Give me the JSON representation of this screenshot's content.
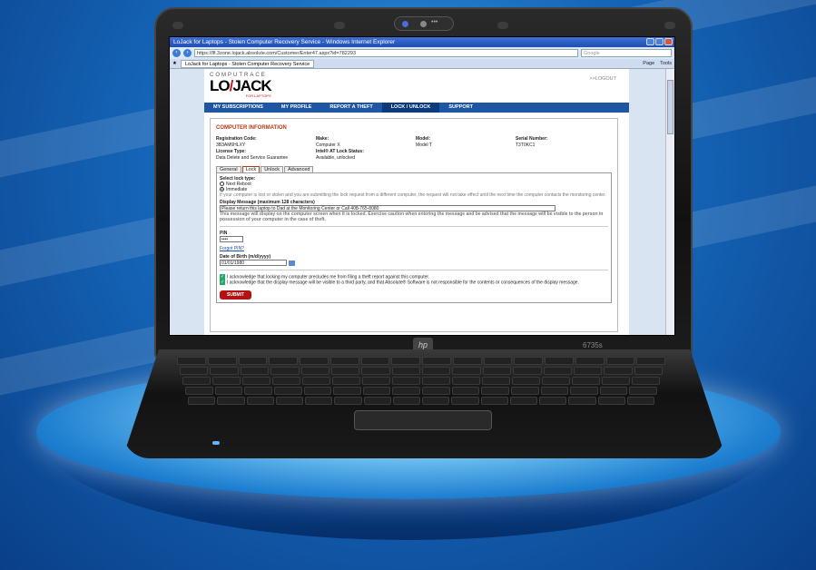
{
  "browser": {
    "window_title": "LoJack for Laptops - Stolen Computer Recovery Service - Windows Internet Explorer",
    "url": "https://lfl.3zone.lojack.absolute.com/Customer/Enter47.aspx?id=782293",
    "search_placeholder": "Google",
    "tab_label": "LoJack for Laptops - Stolen Computer Recovery Service",
    "tools": [
      "Page",
      "Tools"
    ]
  },
  "page": {
    "brand_top": "COMPUTRACE",
    "brand_lo": "LO",
    "brand_jack": "JACK",
    "brand_sub": "FOR LAPTOPS",
    "logout": ">>LOGOUT",
    "nav": [
      "MY SUBSCRIPTIONS",
      "MY PROFILE",
      "REPORT A THEFT",
      "LOCK / UNLOCK",
      "SUPPORT"
    ],
    "section_title": "COMPUTER INFORMATION",
    "info": {
      "reg_label": "Registration Code:",
      "reg_value": "3B3AM6HLXY",
      "make_label": "Make:",
      "make_value": "Computer X",
      "model_label": "Model:",
      "model_value": "Model T",
      "serial_label": "Serial Number:",
      "serial_value": "T3T0KC1",
      "license_label": "License Type:",
      "license_value": "Data Delete and Service Guarantee",
      "intel_label": "Intel® AT Lock Status:",
      "intel_value": "Available, unlocked"
    },
    "tabs": [
      "General",
      "Lock",
      "Unlock",
      "Advanced"
    ],
    "form": {
      "lock_type_label": "Select lock type:",
      "option_next_reboot": "Next Reboot",
      "option_immediate": "Immediate",
      "lock_note": "If your computer is lost or stolen and you are submitting the lock request from a different computer, the request will not take effect until the next time the computer contacts the monitoring center.",
      "display_label": "Display Message (maximum 128 characters)",
      "display_value": "Please return this laptop to Dad at the Monitoring Center or Call 408-765-8080",
      "display_note": "This message will display on the computer screen when it is locked. Exercise caution when entering the message and be advised that the message will be visible to the person in possession of your computer in the case of theft.",
      "pin_label": "PIN",
      "pin_value": "••••",
      "forgot_pin": "Forgot PIN?",
      "dob_label": "Date of Birth (m/d/yyyy)",
      "dob_value": "01/01/1980",
      "ack1": "I acknowledge that locking my computer precludes me from filing a theft report against this computer.",
      "ack2": "I acknowledge that the display message will be visible to a third party, and that Absolute® Software is not responsible for the contents or consequences of the display message.",
      "submit": "SUBMIT"
    }
  },
  "laptop": {
    "model": "6735s",
    "brand": "hp",
    "webcam_label": "•••"
  },
  "colors": {
    "accent_nav": "#1f56a3",
    "section_title": "#b53a14",
    "submit": "#b31313"
  }
}
